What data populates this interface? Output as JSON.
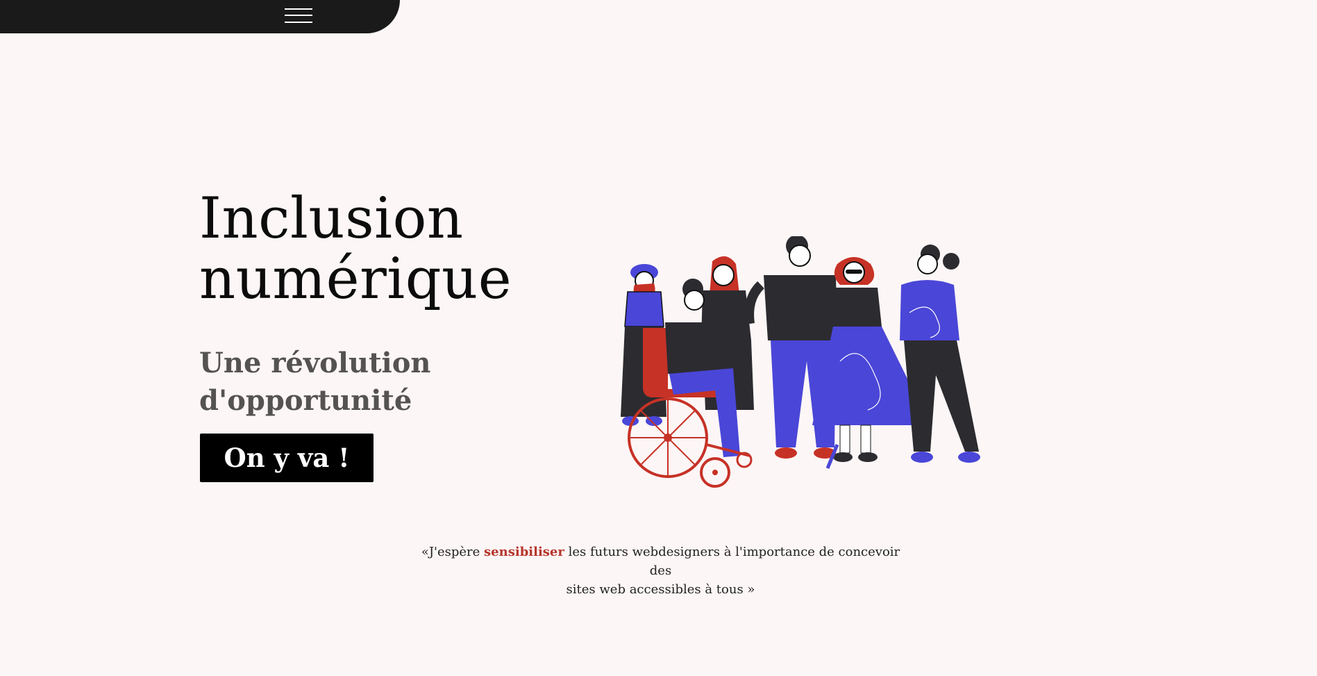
{
  "nav": {
    "menu_icon": "hamburger-menu-icon",
    "background": "#1b1a1a"
  },
  "hero": {
    "title_line1": "Inclusion",
    "title_line2": "numérique",
    "subtitle_line1": "Une révolution",
    "subtitle_line2": "d'opportunité",
    "cta_label": "On y va !"
  },
  "illustration": {
    "subject": "diverse-group-of-people-illustration",
    "colors": {
      "blue": "#4a46d8",
      "red": "#c63225",
      "dark": "#2c2b30"
    }
  },
  "quote": {
    "prefix": "«J'espère ",
    "highlight": "sensibiliser",
    "line1_rest": " les futurs webdesigners à  l'importance de concevoir des",
    "line2": "sites web accessibles à tous »",
    "accent_color": "#b6342a"
  },
  "colors": {
    "page_bg": "#fdf6f6",
    "button_bg": "#000000",
    "subtitle": "#555252"
  }
}
